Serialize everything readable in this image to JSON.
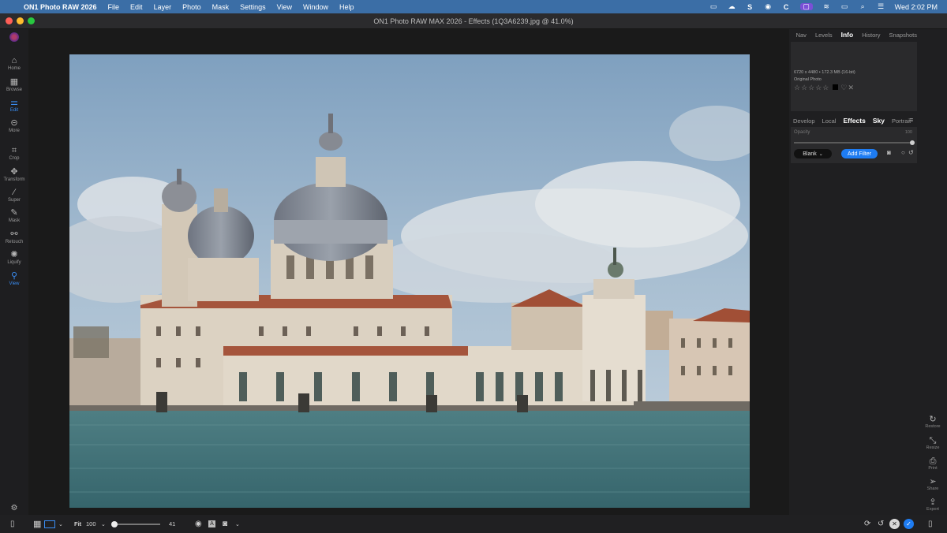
{
  "menubar": {
    "app": "ON1 Photo RAW 2026",
    "items": [
      "File",
      "Edit",
      "Layer",
      "Photo",
      "Mask",
      "Settings",
      "View",
      "Window",
      "Help"
    ],
    "clock": "Wed 2:02 PM"
  },
  "window": {
    "title": "ON1 Photo RAW MAX 2026 - Effects (1Q3A6239.jpg @ 41.0%)"
  },
  "left_tools": [
    {
      "label": "Home",
      "icon": "home-icon"
    },
    {
      "label": "Browse",
      "icon": "grid-icon"
    },
    {
      "label": "Edit",
      "icon": "sliders-icon"
    },
    {
      "label": "More",
      "icon": "more-icon"
    },
    {
      "label": "Crop",
      "icon": "crop-icon"
    },
    {
      "label": "Transform",
      "icon": "move-icon"
    },
    {
      "label": "Super",
      "icon": "wand-icon"
    },
    {
      "label": "Mask",
      "icon": "brush-icon"
    },
    {
      "label": "Retouch",
      "icon": "bandage-icon"
    },
    {
      "label": "Liquify",
      "icon": "liquify-icon"
    },
    {
      "label": "View",
      "icon": "magnifier-icon"
    }
  ],
  "panel": {
    "top_tabs": [
      "Nav",
      "Levels",
      "Info",
      "History",
      "Snapshots"
    ],
    "active_top_tab": "Info",
    "info": {
      "dimensions": "6720 x 4480 • 172.3 MB (16-bit)",
      "original": "Original Photo",
      "stars": "☆☆☆☆☆"
    },
    "edit_tabs": [
      "Develop",
      "Local",
      "Effects",
      "Sky",
      "Portrait"
    ],
    "active_edit_tab": "Effects",
    "opacity_label": "Opacity",
    "opacity_value": "100",
    "opacity_level": 1.0,
    "blank_label": "Blank",
    "add_filter_label": "Add Filter"
  },
  "right_tools": [
    {
      "label": "Restore",
      "icon": "restore-icon"
    },
    {
      "label": "Resize",
      "icon": "resize-icon"
    },
    {
      "label": "Print",
      "icon": "print-icon"
    },
    {
      "label": "Share",
      "icon": "share-icon"
    },
    {
      "label": "Export",
      "icon": "export-icon"
    }
  ],
  "bottom": {
    "fit_label": "Fit",
    "zoom_value": "100",
    "slider_value": "41",
    "slider_level": 0.0
  },
  "colors": {
    "accent": "#1e7cf2",
    "menubar": "#3b6ea6"
  }
}
